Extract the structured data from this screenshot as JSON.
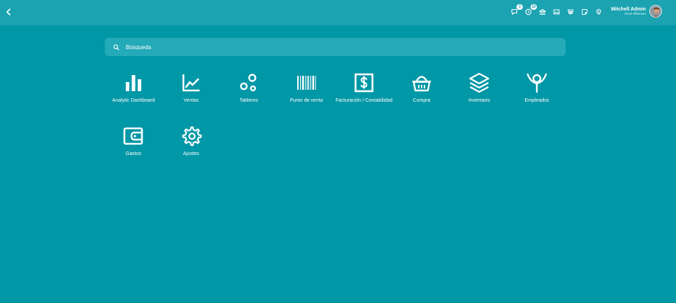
{
  "topbar": {
    "back_icon": "chevron-left-icon",
    "systray": [
      {
        "icon": "chat-icon",
        "badge": "3"
      },
      {
        "icon": "clock-icon",
        "badge": "10"
      },
      {
        "icon": "bank-icon",
        "badge": ""
      },
      {
        "icon": "image-icon",
        "badge": ""
      },
      {
        "icon": "signpost-icon",
        "badge": ""
      },
      {
        "icon": "note-icon",
        "badge": ""
      },
      {
        "icon": "lightbulb-icon",
        "badge": ""
      }
    ],
    "user": {
      "name": "Mitchell Admin",
      "company": "Hood Aflkerson"
    }
  },
  "search": {
    "placeholder": "Búsqueda"
  },
  "apps": [
    {
      "label": "Analytic Dashboard",
      "icon": "bar-chart-icon"
    },
    {
      "label": "Ventas",
      "icon": "line-chart-icon"
    },
    {
      "label": "Tableros",
      "icon": "bubbles-icon"
    },
    {
      "label": "Punto de venta",
      "icon": "barcode-icon"
    },
    {
      "label": "Facturación / Contabilidad",
      "icon": "dollar-invoice-icon"
    },
    {
      "label": "Compra",
      "icon": "basket-icon"
    },
    {
      "label": "Inventario",
      "icon": "layers-icon"
    },
    {
      "label": "Empleados",
      "icon": "person-icon"
    },
    {
      "label": "Gastos",
      "icon": "wallet-icon"
    },
    {
      "label": "Ajustes",
      "icon": "gear-icon"
    }
  ],
  "colors": {
    "background": "#0097a7",
    "topbar": "#1ba3b2",
    "search": "#24aab9",
    "foreground": "#ffffff"
  }
}
